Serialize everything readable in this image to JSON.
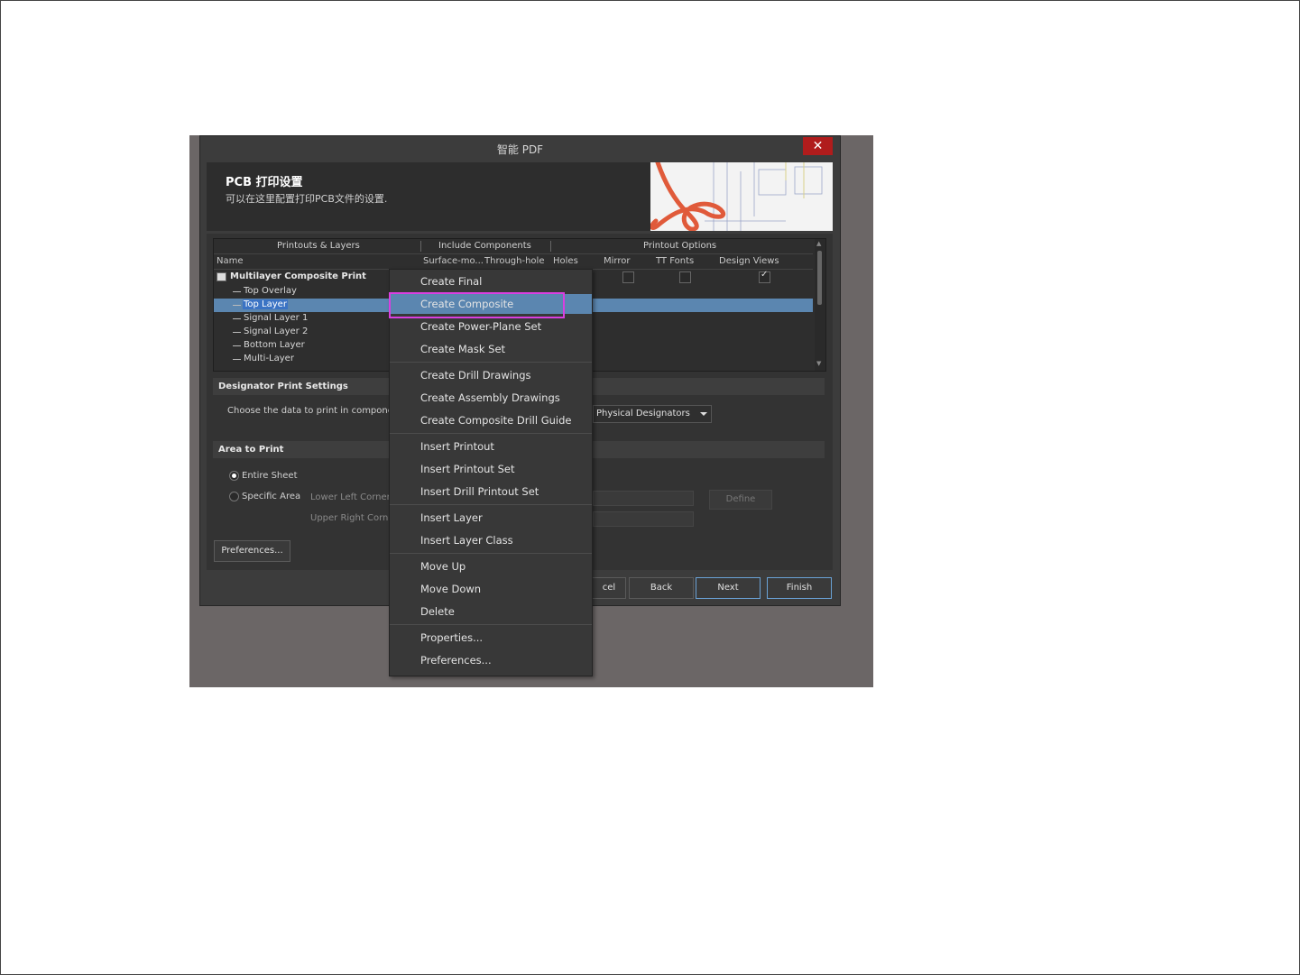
{
  "window": {
    "title": "智能 PDF",
    "close_label": "✕"
  },
  "header": {
    "title": "PCB 打印设置",
    "subtitle": "可以在这里配置打印PCB文件的设置."
  },
  "grid": {
    "groups": [
      "Printouts & Layers",
      "Include Components",
      "Printout Options"
    ],
    "columns": [
      "Name",
      "Surface-mo...",
      "Through-hole",
      "Holes",
      "Mirror",
      "TT Fonts",
      "Design Views"
    ],
    "rows": [
      {
        "label": "Multilayer Composite Print",
        "selected": false
      },
      {
        "label": "Top Overlay",
        "selected": false
      },
      {
        "label": "Top Layer",
        "selected": true
      },
      {
        "label": "Signal Layer 1",
        "selected": false
      },
      {
        "label": "Signal Layer 2",
        "selected": false
      },
      {
        "label": "Bottom Layer",
        "selected": false
      },
      {
        "label": "Multi-Layer",
        "selected": false
      }
    ]
  },
  "designator": {
    "section_title": "Designator Print Settings",
    "description": "Choose the data to print in compone",
    "combo_value": "Physical Designators"
  },
  "area": {
    "section_title": "Area to Print",
    "entire_sheet": "Entire Sheet",
    "specific_area": "Specific Area",
    "lower_left": "Lower Left Corner",
    "upper_right": "Upper Right Corn",
    "define": "Define"
  },
  "buttons": {
    "preferences": "Preferences...",
    "cancel": "cel",
    "back": "Back",
    "next": "Next",
    "finish": "Finish"
  },
  "context_menu": {
    "items": [
      "Create Final",
      "Create Composite",
      "Create Power-Plane Set",
      "Create Mask Set",
      "Create Drill Drawings",
      "Create Assembly Drawings",
      "Create Composite Drill Guide",
      "Insert Printout",
      "Insert Printout Set",
      "Insert Drill Printout Set",
      "Insert Layer",
      "Insert Layer Class",
      "Move Up",
      "Move Down",
      "Delete",
      "Properties...",
      "Preferences..."
    ],
    "hovered_item": "Create Composite"
  },
  "colors": {
    "selection": "#5b86b0",
    "highlight_box": "#d93fe0",
    "close_button": "#b01c1c"
  }
}
